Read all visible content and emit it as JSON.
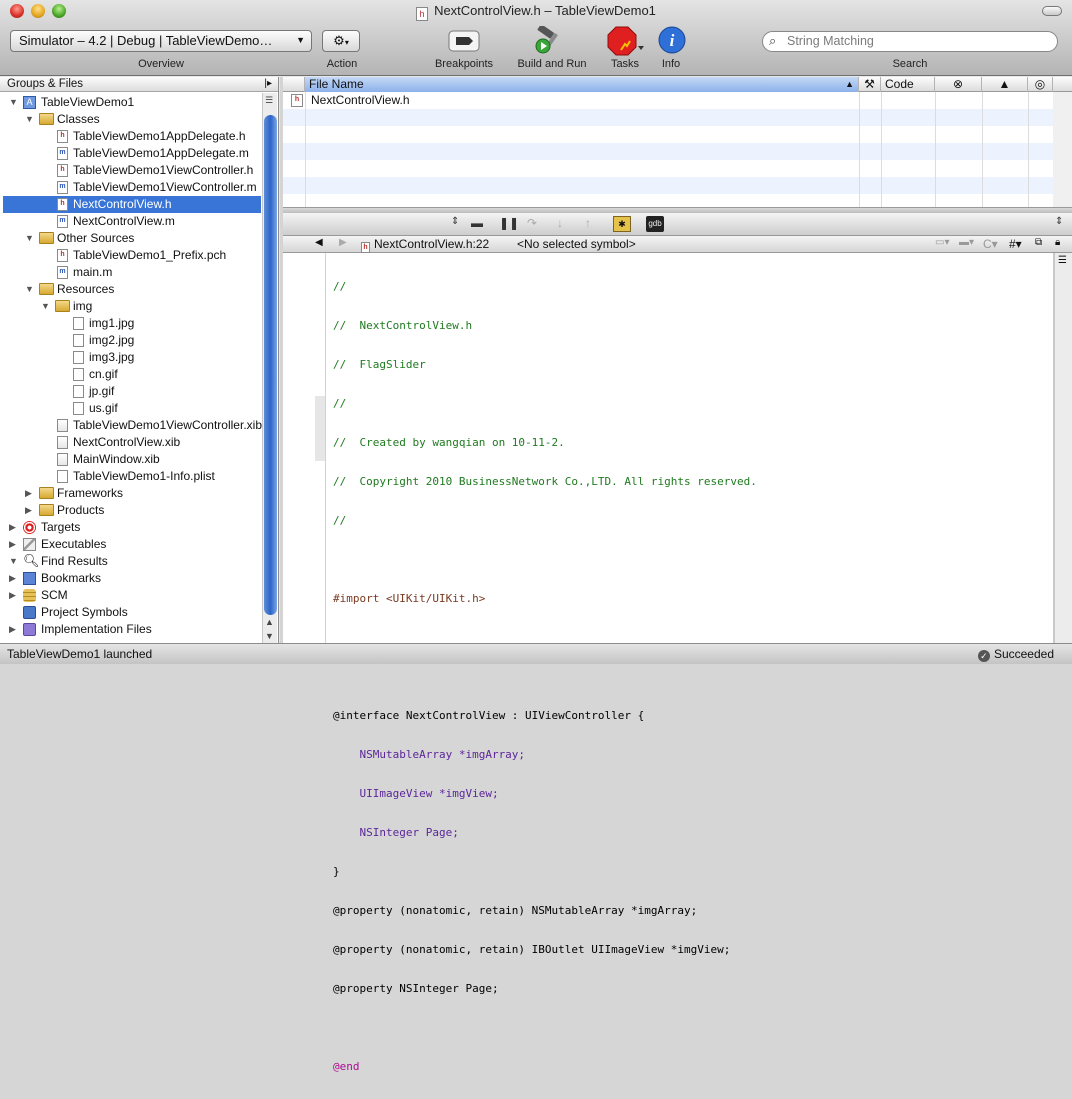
{
  "window": {
    "title": "NextControlView.h – TableViewDemo1"
  },
  "toolbar": {
    "overview_value": "Simulator – 4.2 | Debug | TableViewDemo…",
    "overview_label": "Overview",
    "action_label": "Action",
    "breakpoints_label": "Breakpoints",
    "build_run_label": "Build and Run",
    "tasks_label": "Tasks",
    "info_label": "Info",
    "search_placeholder": "String Matching",
    "search_label": "Search"
  },
  "sidebar": {
    "header": "Groups & Files",
    "items": [
      {
        "label": "TableViewDemo1",
        "icon": "project-icon"
      },
      {
        "label": "Classes",
        "icon": "folder-icon"
      },
      {
        "label": "TableViewDemo1AppDelegate.h",
        "icon": "header-file-icon"
      },
      {
        "label": "TableViewDemo1AppDelegate.m",
        "icon": "implementation-file-icon"
      },
      {
        "label": "TableViewDemo1ViewController.h",
        "icon": "header-file-icon"
      },
      {
        "label": "TableViewDemo1ViewController.m",
        "icon": "implementation-file-icon"
      },
      {
        "label": "NextControlView.h",
        "icon": "header-file-icon"
      },
      {
        "label": "NextControlView.m",
        "icon": "implementation-file-icon"
      },
      {
        "label": "Other Sources",
        "icon": "folder-icon"
      },
      {
        "label": "TableViewDemo1_Prefix.pch",
        "icon": "header-file-icon"
      },
      {
        "label": "main.m",
        "icon": "implementation-file-icon"
      },
      {
        "label": "Resources",
        "icon": "folder-icon"
      },
      {
        "label": "img",
        "icon": "folder-icon"
      },
      {
        "label": "img1.jpg",
        "icon": "image-file-icon"
      },
      {
        "label": "img2.jpg",
        "icon": "image-file-icon"
      },
      {
        "label": "img3.jpg",
        "icon": "image-file-icon"
      },
      {
        "label": "cn.gif",
        "icon": "image-file-icon"
      },
      {
        "label": "jp.gif",
        "icon": "image-file-icon"
      },
      {
        "label": "us.gif",
        "icon": "image-file-icon"
      },
      {
        "label": "TableViewDemo1ViewController.xib",
        "icon": "xib-file-icon"
      },
      {
        "label": "NextControlView.xib",
        "icon": "xib-file-icon"
      },
      {
        "label": "MainWindow.xib",
        "icon": "xib-file-icon"
      },
      {
        "label": "TableViewDemo1-Info.plist",
        "icon": "plist-file-icon"
      },
      {
        "label": "Frameworks",
        "icon": "folder-icon"
      },
      {
        "label": "Products",
        "icon": "folder-icon"
      },
      {
        "label": "Targets",
        "icon": "target-icon"
      },
      {
        "label": "Executables",
        "icon": "executables-icon"
      },
      {
        "label": "Find Results",
        "icon": "find-icon"
      },
      {
        "label": "Bookmarks",
        "icon": "bookmarks-icon"
      },
      {
        "label": "SCM",
        "icon": "scm-icon"
      },
      {
        "label": "Project Symbols",
        "icon": "symbols-icon"
      },
      {
        "label": "Implementation Files",
        "icon": "implementation-files-icon"
      }
    ]
  },
  "file_table": {
    "col_file_name": "File Name",
    "col_code": "Code",
    "rows": [
      "NextControlView.h"
    ]
  },
  "nav": {
    "file": "NextControlView.h:22",
    "symbol": "<No selected symbol>"
  },
  "editor": {
    "lines": [
      "//",
      "//  NextControlView.h",
      "//  FlagSlider",
      "//",
      "//  Created by wangqian on 10-11-2.",
      "//  Copyright 2010 BusinessNetwork Co.,LTD. All rights reserved.",
      "//",
      "",
      "#import <UIKit/UIKit.h>",
      "",
      "",
      "@interface NextControlView : UIViewController {",
      "    NSMutableArray *imgArray;",
      "    UIImageView *imgView;",
      "    NSInteger Page;",
      "}",
      "@property (nonatomic, retain) NSMutableArray *imgArray;",
      "@property (nonatomic, retain) IBOutlet UIImageView *imgView;",
      "@property NSInteger Page;",
      "",
      "@end"
    ]
  },
  "status": {
    "left": "TableViewDemo1 launched",
    "right": "Succeeded"
  },
  "colors": {
    "selection": "#3875d7",
    "comment": "#1f7a1f",
    "keyword": "#aa0d91",
    "string": "#c41a16"
  }
}
